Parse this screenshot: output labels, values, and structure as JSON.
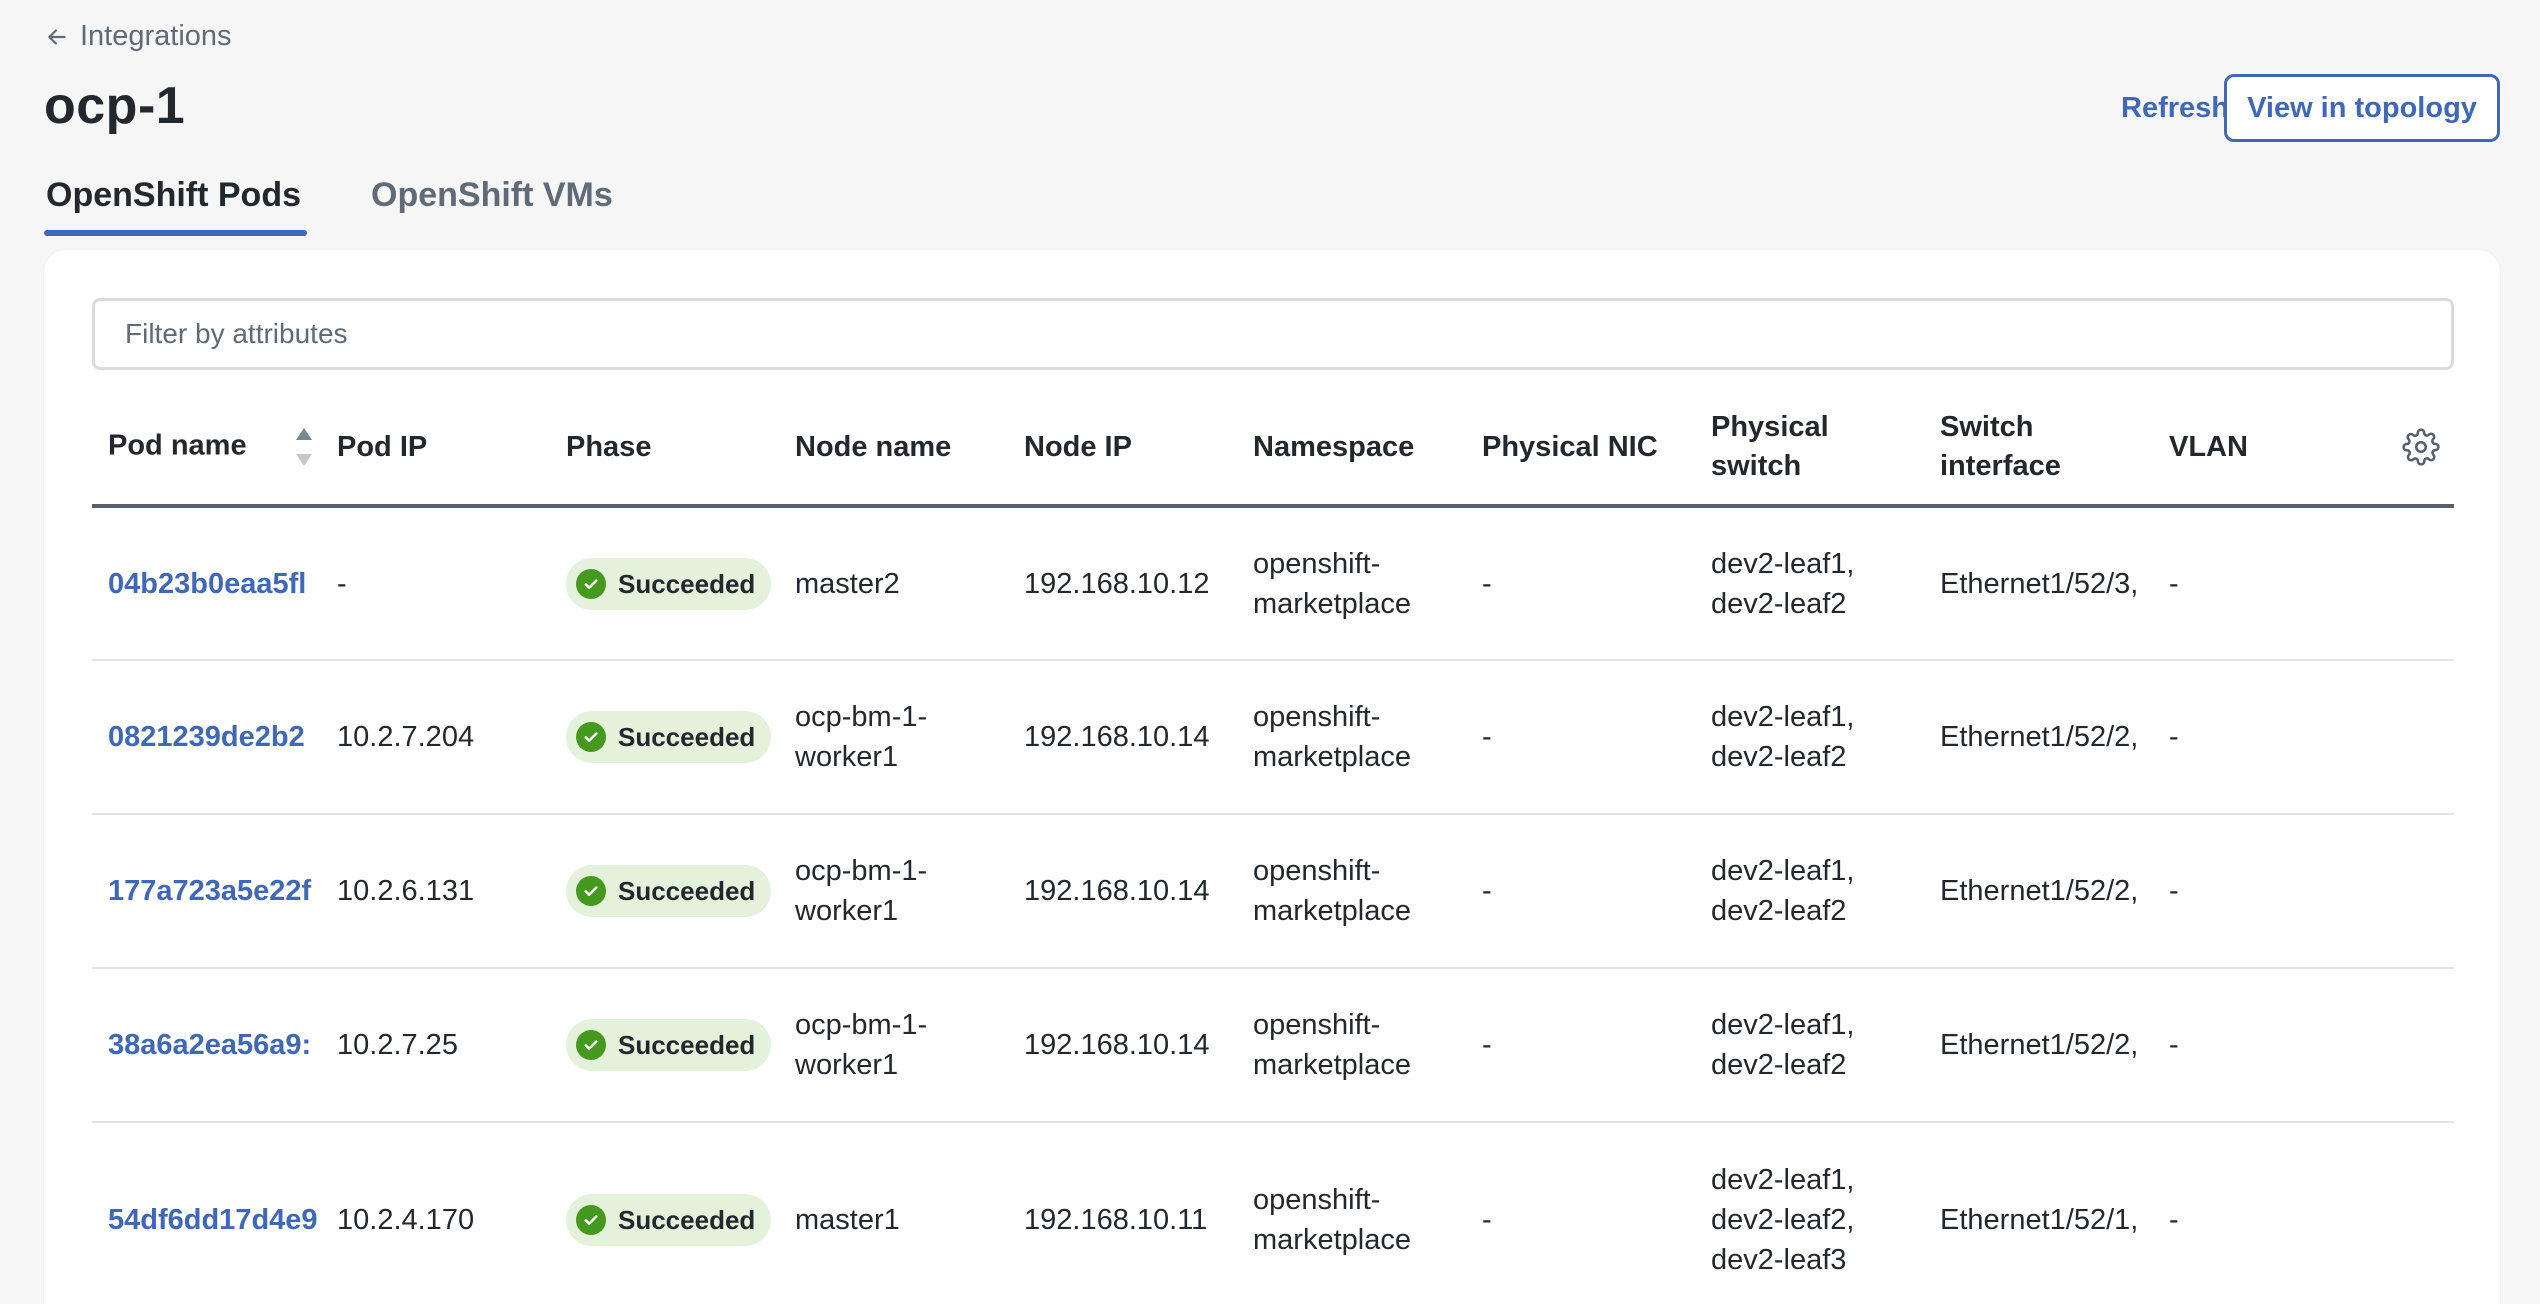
{
  "breadcrumb": {
    "label": "Integrations"
  },
  "page": {
    "title": "ocp-1"
  },
  "actions": {
    "refresh": "Refresh",
    "view_topology": "View in topology"
  },
  "tabs": [
    {
      "label": "OpenShift Pods",
      "active": true
    },
    {
      "label": "OpenShift VMs",
      "active": false
    }
  ],
  "filter": {
    "placeholder": "Filter by attributes",
    "value": ""
  },
  "table": {
    "columns": [
      "Pod name",
      "Pod IP",
      "Phase",
      "Node name",
      "Node IP",
      "Namespace",
      "Physical NIC",
      "Physical switch",
      "Switch interface",
      "VLAN"
    ],
    "sorted_column": "Pod name",
    "rows": [
      {
        "pod_name": "04b23b0eaa5fl",
        "pod_ip": "-",
        "phase": "Succeeded",
        "node_name": "master2",
        "node_ip": "192.168.10.12",
        "namespace": "openshift-marketplace",
        "physical_nic": "-",
        "physical_switch": "dev2-leaf1,dev2-leaf2",
        "switch_interface": "Ethernet1/52/3,",
        "vlan": "-"
      },
      {
        "pod_name": "0821239de2b2",
        "pod_ip": "10.2.7.204",
        "phase": "Succeeded",
        "node_name": "ocp-bm-1-worker1",
        "node_ip": "192.168.10.14",
        "namespace": "openshift-marketplace",
        "physical_nic": "-",
        "physical_switch": "dev2-leaf1,dev2-leaf2",
        "switch_interface": "Ethernet1/52/2,",
        "vlan": "-"
      },
      {
        "pod_name": "177a723a5e22f",
        "pod_ip": "10.2.6.131",
        "phase": "Succeeded",
        "node_name": "ocp-bm-1-worker1",
        "node_ip": "192.168.10.14",
        "namespace": "openshift-marketplace",
        "physical_nic": "-",
        "physical_switch": "dev2-leaf1,dev2-leaf2",
        "switch_interface": "Ethernet1/52/2,",
        "vlan": "-"
      },
      {
        "pod_name": "38a6a2ea56a9:",
        "pod_ip": "10.2.7.25",
        "phase": "Succeeded",
        "node_name": "ocp-bm-1-worker1",
        "node_ip": "192.168.10.14",
        "namespace": "openshift-marketplace",
        "physical_nic": "-",
        "physical_switch": "dev2-leaf1,dev2-leaf2",
        "switch_interface": "Ethernet1/52/2,",
        "vlan": "-"
      },
      {
        "pod_name": "54df6dd17d4e9",
        "pod_ip": "10.2.4.170",
        "phase": "Succeeded",
        "node_name": "master1",
        "node_ip": "192.168.10.11",
        "namespace": "openshift-marketplace",
        "physical_nic": "-",
        "physical_switch": "dev2-leaf1,dev2-leaf2,dev2-leaf3",
        "switch_interface": "Ethernet1/52/1,",
        "vlan": "-"
      }
    ]
  },
  "colors": {
    "accent": "#3f68b8",
    "success": "#45991f",
    "success_bg": "#e5f2db"
  },
  "icons": {
    "back": "arrow-left-icon",
    "sort": "sort-icon",
    "settings": "gear-icon",
    "status": "check-circle-icon"
  }
}
